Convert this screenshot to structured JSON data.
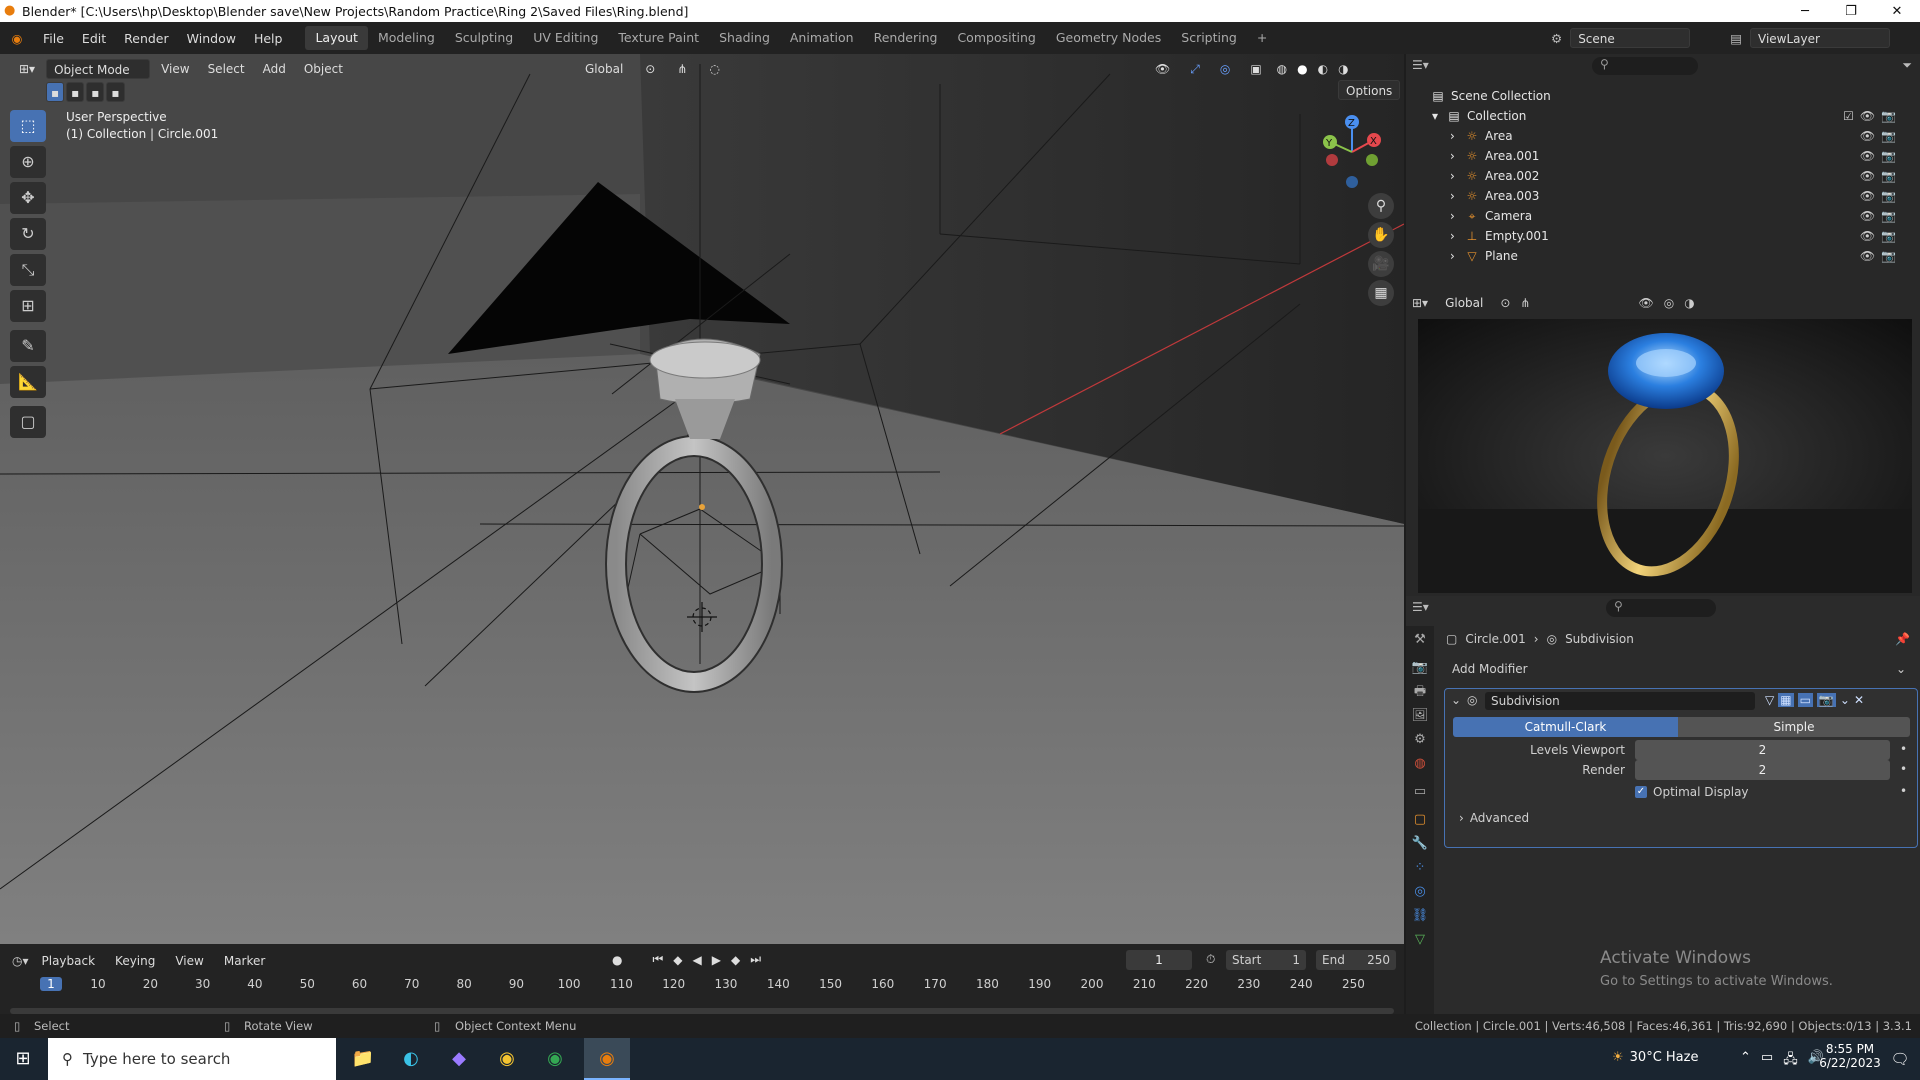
{
  "window": {
    "title": "Blender* [C:\\Users\\hp\\Desktop\\Blender save\\New Projects\\Random Practice\\Ring 2\\Saved Files\\Ring.blend]"
  },
  "menubar": {
    "items": [
      "File",
      "Edit",
      "Render",
      "Window",
      "Help"
    ]
  },
  "workspaces": [
    "Layout",
    "Modeling",
    "Sculpting",
    "UV Editing",
    "Texture Paint",
    "Shading",
    "Animation",
    "Rendering",
    "Compositing",
    "Geometry Nodes",
    "Scripting"
  ],
  "scene": {
    "label": "Scene",
    "view_layer": "ViewLayer"
  },
  "viewport": {
    "mode": "Object Mode",
    "menus": [
      "View",
      "Select",
      "Add",
      "Object"
    ],
    "transform": "Global",
    "options": "Options",
    "info_title": "User Perspective",
    "info_sub": "(1) Collection | Circle.001",
    "gizmo_axes": [
      "X",
      "Y",
      "Z"
    ]
  },
  "outliner": {
    "root": "Scene Collection",
    "collection": "Collection",
    "items": [
      {
        "name": "Area",
        "icon": "light-icon"
      },
      {
        "name": "Area.001",
        "icon": "light-icon"
      },
      {
        "name": "Area.002",
        "icon": "light-icon"
      },
      {
        "name": "Area.003",
        "icon": "light-icon"
      },
      {
        "name": "Camera",
        "icon": "camera-icon"
      },
      {
        "name": "Empty.001",
        "icon": "empty-icon"
      },
      {
        "name": "Plane",
        "icon": "mesh-icon"
      }
    ]
  },
  "render_preview": {
    "transform": "Global"
  },
  "properties": {
    "breadcrumb_object": "Circle.001",
    "breadcrumb_modifier": "Subdivision",
    "add_modifier": "Add Modifier",
    "modifier_name": "Subdivision",
    "tabs": {
      "catmull": "Catmull-Clark",
      "simple": "Simple"
    },
    "levels_viewport_label": "Levels Viewport",
    "levels_viewport": "2",
    "render_label": "Render",
    "render_value": "2",
    "optimal_display": "Optimal Display",
    "advanced": "Advanced"
  },
  "timeline": {
    "menus": [
      "Playback",
      "Keying",
      "View",
      "Marker"
    ],
    "current_frame": "1",
    "start_label": "Start",
    "start": "1",
    "end_label": "End",
    "end": "250",
    "ruler": [
      "1",
      "10",
      "20",
      "30",
      "40",
      "50",
      "60",
      "70",
      "80",
      "90",
      "100",
      "110",
      "120",
      "130",
      "140",
      "150",
      "160",
      "170",
      "180",
      "190",
      "200",
      "210",
      "220",
      "230",
      "240",
      "250"
    ]
  },
  "statusbar": {
    "select": "Select",
    "rotate": "Rotate View",
    "context": "Object Context Menu",
    "stats": "Collection | Circle.001 | Verts:46,508 | Faces:46,361 | Tris:92,690 | Objects:0/13 | 3.3.1"
  },
  "watermark": {
    "line1": "Activate Windows",
    "line2": "Go to Settings to activate Windows."
  },
  "taskbar": {
    "search": "Type here to search",
    "weather": "30°C  Haze",
    "time": "8:55 PM",
    "date": "6/22/2023"
  }
}
